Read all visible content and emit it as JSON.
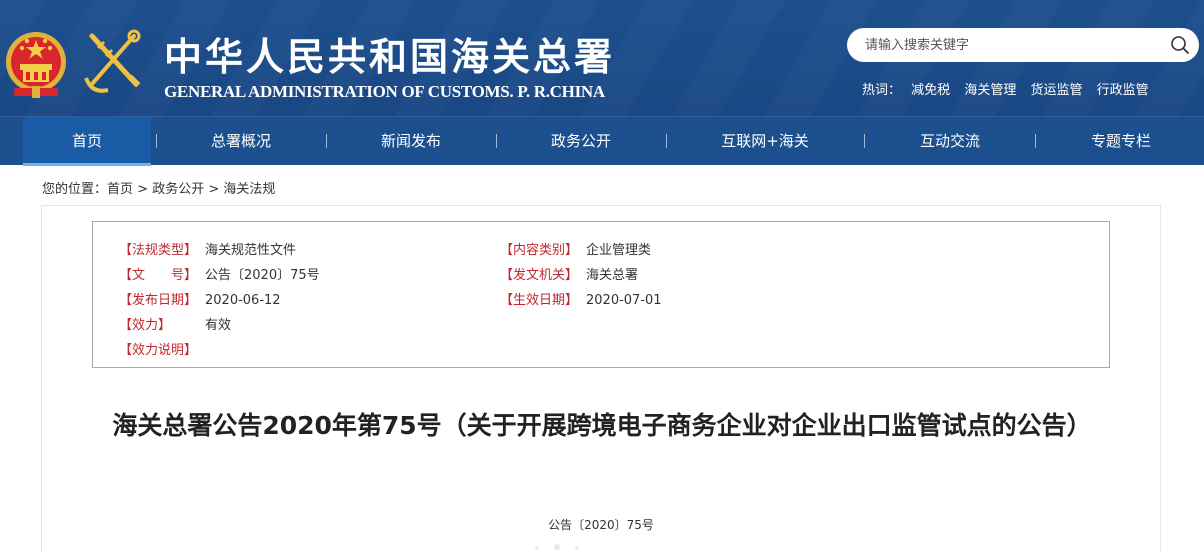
{
  "header": {
    "title_cn": "中华人民共和国海关总署",
    "title_en": "GENERAL ADMINISTRATION OF CUSTOMS. P. R.CHINA",
    "search_placeholder": "请输入搜索关键字",
    "hot_label": "热词：",
    "hot_words": [
      "减免税",
      "海关管理",
      "货运监管",
      "行政监管"
    ]
  },
  "nav": {
    "items": [
      "首页",
      "总署概况",
      "新闻发布",
      "政务公开",
      "互联网+海关",
      "互动交流",
      "专题专栏"
    ],
    "active": "首页"
  },
  "breadcrumb": {
    "prefix": "您的位置：",
    "items": [
      "首页",
      "政务公开",
      "海关法规"
    ],
    "separator": ">"
  },
  "meta": {
    "left": [
      {
        "label": "【法规类型】",
        "value": "海关规范性文件"
      },
      {
        "label": "【文　　号】",
        "value": "公告〔2020〕75号"
      },
      {
        "label": "【发布日期】",
        "value": "2020-06-12"
      },
      {
        "label": "【效力】",
        "value": "有效"
      },
      {
        "label": "【效力说明】",
        "value": ""
      }
    ],
    "right": [
      {
        "label": "【内容类别】",
        "value": "企业管理类"
      },
      {
        "label": "【发文机关】",
        "value": "海关总署"
      },
      {
        "label": "【生效日期】",
        "value": "2020-07-01"
      }
    ]
  },
  "document": {
    "title": "海关总署公告2020年第75号（关于开展跨境电子商务企业对企业出口监管试点的公告）",
    "number": "公告〔2020〕75号"
  },
  "colors": {
    "header_bg": "#1b4b88",
    "nav_bg": "#1c4f8d",
    "label_red": "#c0282d"
  }
}
